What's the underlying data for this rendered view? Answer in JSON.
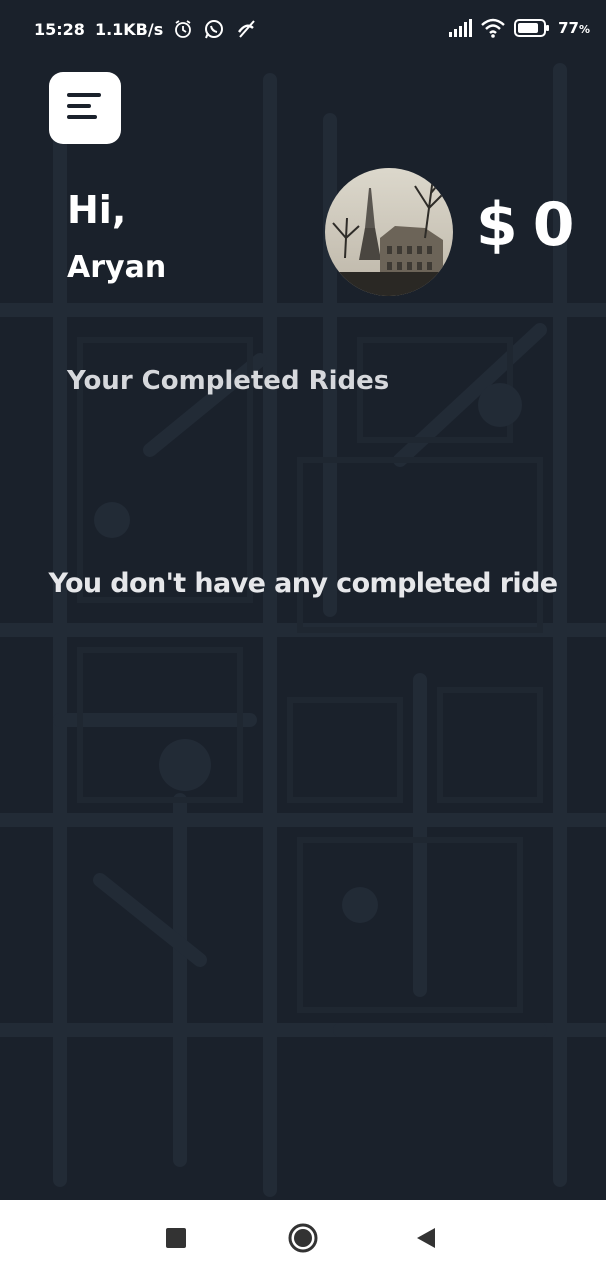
{
  "status_bar": {
    "time": "15:28",
    "network_speed": "1.1KB/s",
    "battery_percent": "77",
    "battery_unit": "%",
    "icons": [
      "alarm-icon",
      "whatsapp-icon",
      "missed-call-icon",
      "signal-icon",
      "wifi-icon",
      "battery-icon"
    ]
  },
  "header": {
    "menu_icon": "hamburger-menu-icon",
    "greeting": "Hi,",
    "user_name": "Aryan",
    "balance_currency": "$",
    "balance_value": "0"
  },
  "main": {
    "section_title": "Your Completed Rides",
    "empty_message": "You don't have any completed ride"
  },
  "nav_bar": {
    "buttons": [
      "recents-square-icon",
      "home-circle-icon",
      "back-triangle-icon"
    ]
  },
  "colors": {
    "background": "#1a212b",
    "text_primary": "#ffffff",
    "text_secondary": "#d6d8dc",
    "nav_background": "#ffffff"
  }
}
